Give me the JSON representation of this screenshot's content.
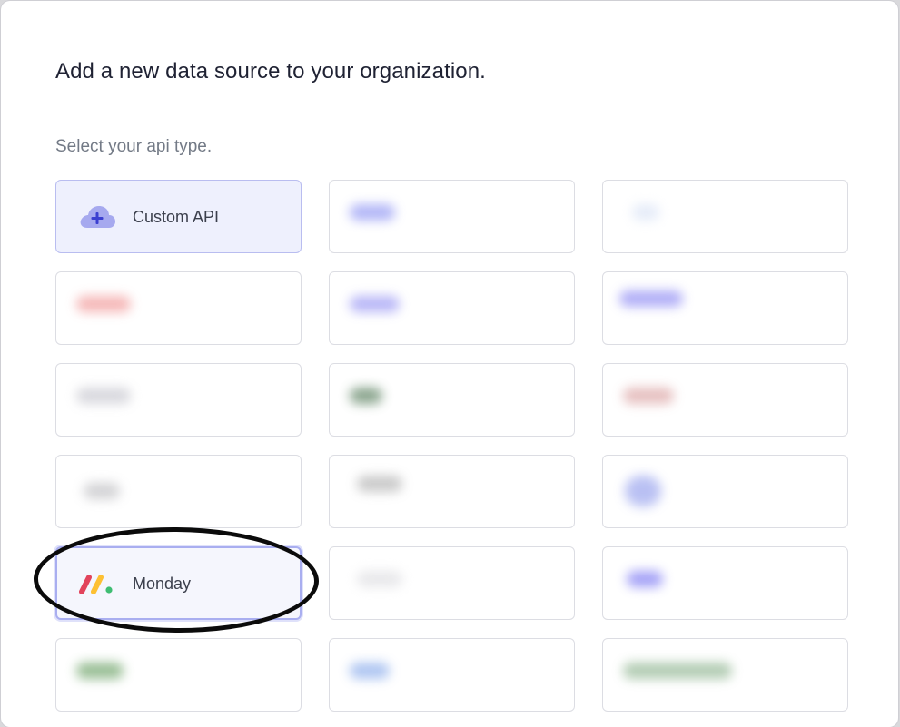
{
  "modal": {
    "title": "Add a new data source to your organization.",
    "subtitle": "Select your api type."
  },
  "cards": [
    {
      "label": "Custom API",
      "icon": "cloud-plus-icon"
    },
    {
      "label": "",
      "blur_color": "#9ea3f5"
    },
    {
      "label": "",
      "blur_color": "#dfe7f7"
    },
    {
      "label": "",
      "blur_color": "#f3a6a6"
    },
    {
      "label": "",
      "blur_color": "#a7a5f5"
    },
    {
      "label": "",
      "blur_color": "#9d9af5"
    },
    {
      "label": "",
      "blur_color": "#cfcfd6"
    },
    {
      "label": "",
      "blur_color": "#6e8f72"
    },
    {
      "label": "",
      "blur_color": "#e0b0b0"
    },
    {
      "label": "",
      "blur_color": "#c9c9cc"
    },
    {
      "label": "",
      "blur_color": "#bdbdbd"
    },
    {
      "label": "",
      "blur_color": "#a8b1f0"
    },
    {
      "label": "Monday",
      "icon": "monday-logo-icon"
    },
    {
      "label": "",
      "blur_color": "#e3e3e6"
    },
    {
      "label": "",
      "blur_color": "#8f8cf5"
    },
    {
      "label": "",
      "blur_color": "#7fae7a"
    },
    {
      "label": "",
      "blur_color": "#9ab7ee"
    },
    {
      "label": "",
      "blur_color": "#9fbfa0"
    }
  ],
  "colors": {
    "accent": "#6f73e8",
    "monday_red": "#e2445c",
    "monday_yellow": "#fdc033",
    "monday_green": "#3fbd72"
  }
}
